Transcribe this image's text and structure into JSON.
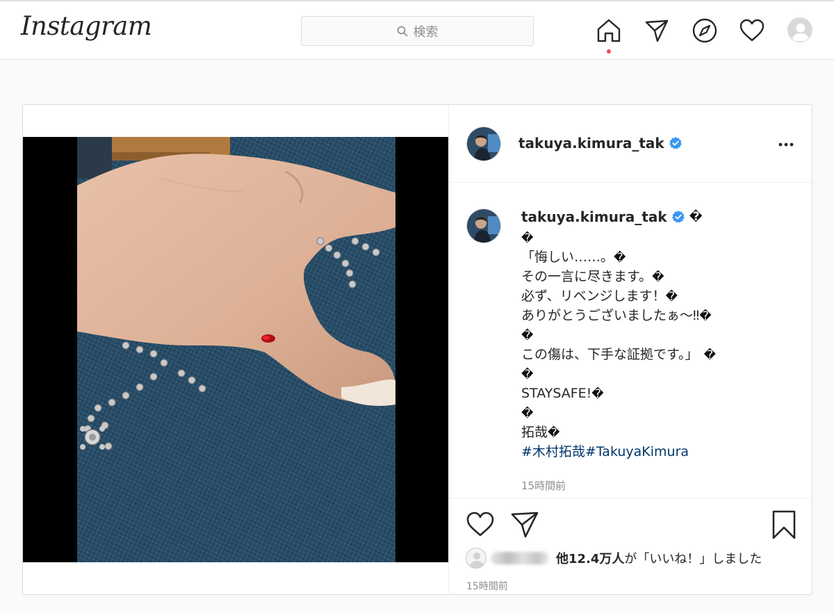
{
  "nav": {
    "logo": "Instagram",
    "search_placeholder": "検索",
    "icons": [
      "home-icon",
      "direct-message-icon",
      "explore-compass-icon",
      "activity-heart-icon",
      "profile-avatar"
    ]
  },
  "post": {
    "username": "takuya.kimura_tak",
    "verified": true,
    "caption_lines": [
      {
        "text": "takuya.kimura_tak",
        "bold": true
      },
      {
        "text": ""
      },
      {
        "text": "「悔しい……。"
      },
      {
        "text": "その一言に尽きます。"
      },
      {
        "text": "必ず、リベンジします！"
      },
      {
        "text": "ありがとうございましたぁ〜‼︎"
      },
      {
        "text": ""
      },
      {
        "text": "この傷は、下手な証拠です。」"
      },
      {
        "text": ""
      },
      {
        "text": "STAYSAFE!"
      },
      {
        "text": ""
      },
      {
        "text": "拓哉"
      }
    ],
    "unknown_glyph": "�",
    "hashtags": "#木村拓哉#TakuyaKimura",
    "caption_time": "15時間前",
    "likes_count_text": "他12.4万人",
    "likes_suffix": "が「いいね！」しました",
    "post_time": "15時間前"
  },
  "colors": {
    "accent_link": "#00376b",
    "verified_blue": "#3897f0",
    "notification_dot": "#ed4956",
    "border": "#dbdbdb",
    "background": "#fafafa"
  }
}
